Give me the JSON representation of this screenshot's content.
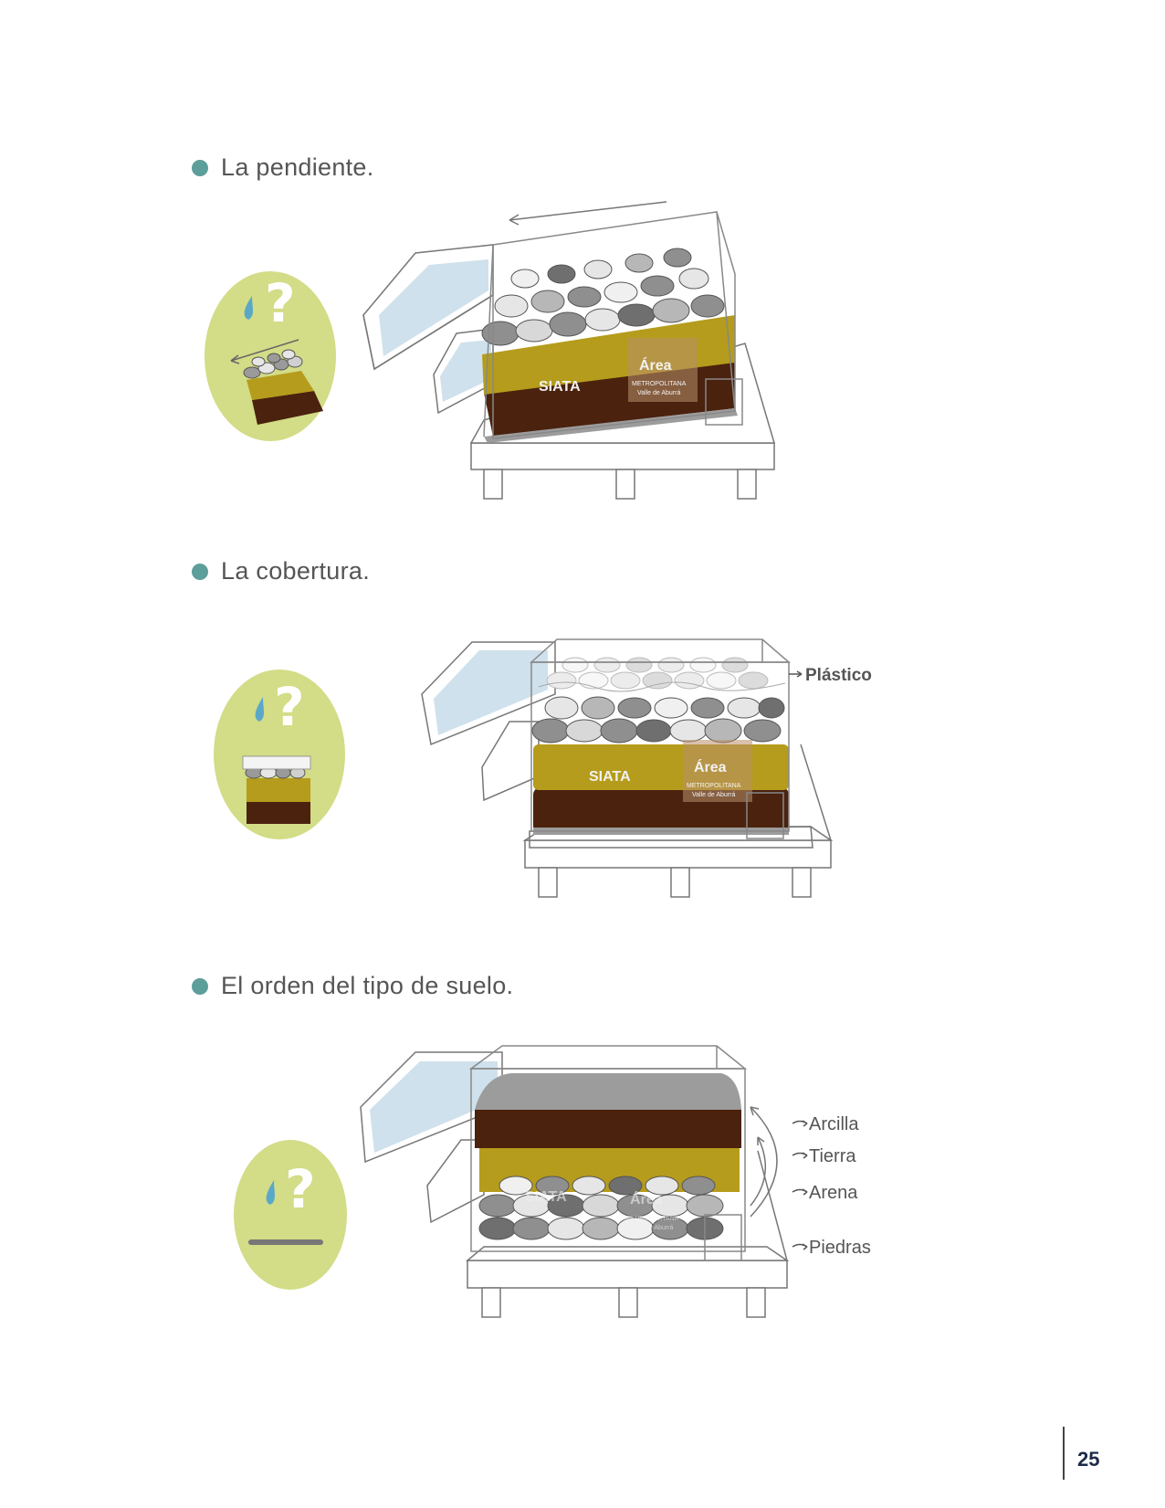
{
  "headings": {
    "slope": "La pendiente.",
    "cover": "La cobertura.",
    "order": "El orden del tipo de suelo."
  },
  "labels": {
    "plastic": "Plástico",
    "clay": "Arcilla",
    "earth": "Tierra",
    "sand": "Arena",
    "stones": "Piedras"
  },
  "logos": {
    "siata": "SIATA",
    "area_script": "Área",
    "metro": "METROPOLITANA",
    "valle": "Valle de Aburrá"
  },
  "icons": {
    "question": "?",
    "names": [
      "water-drop-icon",
      "question-mark-icon"
    ]
  },
  "page": {
    "number": "25"
  },
  "colors": {
    "bullet": "#5b9e9a",
    "blob": "#d3dc86",
    "sand": "#b59c1c",
    "soil": "#4a220e",
    "stone": "#8f8f8f",
    "water": "#cfe1ec"
  }
}
